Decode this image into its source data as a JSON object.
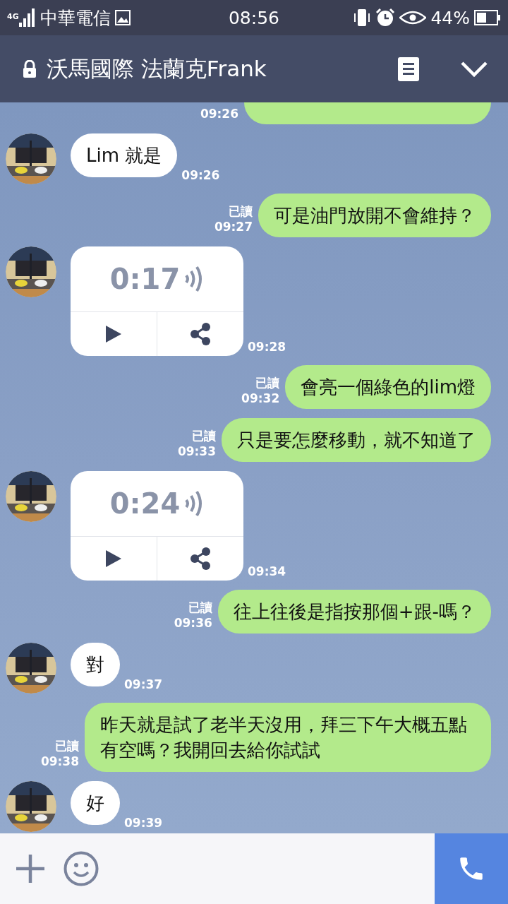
{
  "status_bar": {
    "network": "4G",
    "carrier": "中華電信",
    "time": "08:56",
    "battery": "44%"
  },
  "header": {
    "title": "沃馬國際 法蘭克Frank"
  },
  "messages": [
    {
      "kind": "cut",
      "outgoing": true,
      "time": "09:26"
    },
    {
      "kind": "text",
      "outgoing": false,
      "text": "Lim  就是",
      "time": "09:26"
    },
    {
      "kind": "text",
      "outgoing": true,
      "read": "已讀",
      "text": "可是油門放開不會維持？",
      "time": "09:27"
    },
    {
      "kind": "voice",
      "outgoing": false,
      "duration": "0:17",
      "time": "09:28"
    },
    {
      "kind": "text",
      "outgoing": true,
      "read": "已讀",
      "text": "會亮一個綠色的lim燈",
      "time": "09:32"
    },
    {
      "kind": "text",
      "outgoing": true,
      "read": "已讀",
      "text": "只是要怎麼移動，就不知道了",
      "time": "09:33"
    },
    {
      "kind": "voice",
      "outgoing": false,
      "duration": "0:24",
      "time": "09:34"
    },
    {
      "kind": "text",
      "outgoing": true,
      "read": "已讀",
      "text": "往上往後是指按那個+跟-嗎？",
      "time": "09:36"
    },
    {
      "kind": "text",
      "outgoing": false,
      "text": "對",
      "time": "09:37"
    },
    {
      "kind": "text",
      "outgoing": true,
      "read": "已讀",
      "text": "昨天就是試了老半天沒用，拜三下午大概五點有空嗎？我開回去給你試試",
      "time": "09:38"
    },
    {
      "kind": "text",
      "outgoing": false,
      "text": "好",
      "time": "09:39"
    }
  ]
}
